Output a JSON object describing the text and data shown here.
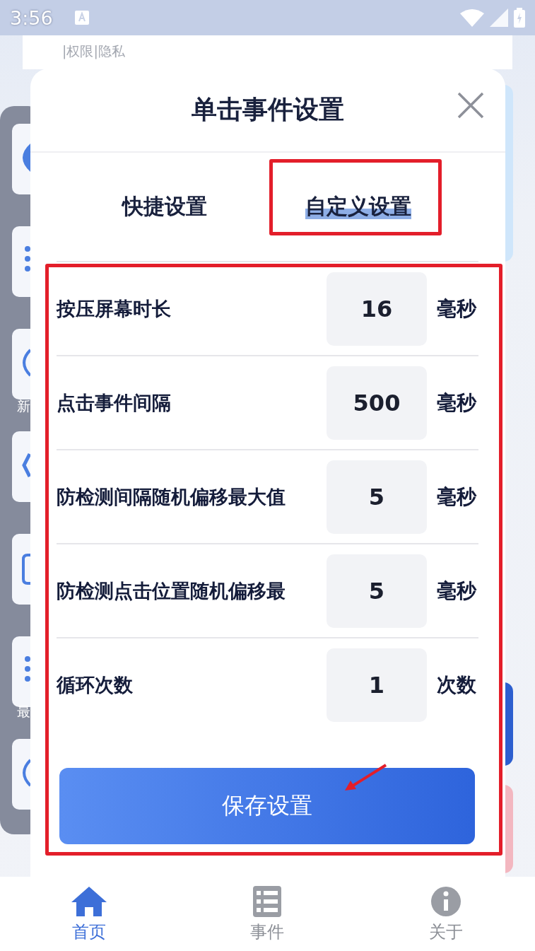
{
  "status_bar": {
    "time": "3:56"
  },
  "background": {
    "card_text": "|权限|隐私",
    "side_labels": [
      "新",
      "最"
    ]
  },
  "dialog": {
    "title": "单击事件设置",
    "tabs": [
      {
        "label": "快捷设置",
        "selected": false
      },
      {
        "label": "自定义设置",
        "selected": true
      }
    ],
    "rows": [
      {
        "label": "按压屏幕时长",
        "value": "16",
        "unit": "毫秒"
      },
      {
        "label": "点击事件间隔",
        "value": "500",
        "unit": "毫秒"
      },
      {
        "label": "防检测间隔随机偏移最大值",
        "value": "5",
        "unit": "毫秒"
      },
      {
        "label": "防检测点击位置随机偏移最",
        "value": "5",
        "unit": "毫秒"
      },
      {
        "label": "循环次数",
        "value": "1",
        "unit": "次数"
      }
    ],
    "save_button": "保存设置"
  },
  "annotations": [
    {
      "kind": "box"
    },
    {
      "kind": "box"
    },
    {
      "kind": "arrow"
    }
  ],
  "bottom_nav": [
    {
      "label": "首页",
      "selected": true
    },
    {
      "label": "事件",
      "selected": false
    },
    {
      "label": "关于",
      "selected": false
    }
  ]
}
